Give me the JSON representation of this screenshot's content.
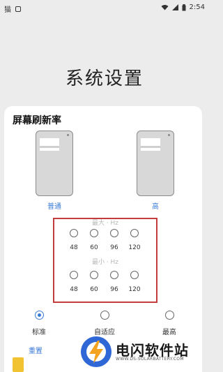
{
  "status_bar": {
    "left_glyph": "猫",
    "time": "2:54"
  },
  "page_title": "系统设置",
  "dialog": {
    "title": "屏幕刷新率",
    "modes": [
      {
        "label": "普通"
      },
      {
        "label": "高"
      }
    ],
    "max_caption": "最大 · Hz",
    "min_caption": "最小 · Hz",
    "max_rates": [
      "48",
      "60",
      "96",
      "120"
    ],
    "min_rates": [
      "48",
      "60",
      "96",
      "120"
    ],
    "options": [
      {
        "label": "标准",
        "checked": true
      },
      {
        "label": "自适应",
        "checked": false
      },
      {
        "label": "最高",
        "checked": false
      }
    ],
    "reset_label": "重置"
  },
  "watermark": {
    "title": "电闪软件站",
    "url": "WWW.DS-SOLARBATTERY.COM"
  },
  "colors": {
    "accent": "#3b7bd8",
    "highlight_box": "#c43b3b",
    "background": "#ececec"
  }
}
